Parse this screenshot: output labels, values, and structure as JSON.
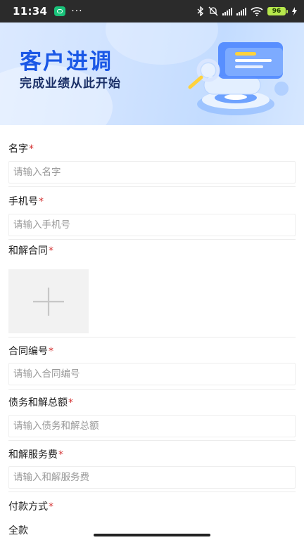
{
  "status_bar": {
    "time": "11:34",
    "more": "···",
    "battery": "96"
  },
  "banner": {
    "title": "客户进调",
    "subtitle": "完成业绩从此开始"
  },
  "form": {
    "name": {
      "label": "名字",
      "required": "*",
      "placeholder": "请输入名字"
    },
    "phone": {
      "label": "手机号",
      "required": "*",
      "placeholder": "请输入手机号"
    },
    "contract": {
      "label": "和解合同",
      "required": "*"
    },
    "contract_no": {
      "label": "合同编号",
      "required": "*",
      "placeholder": "请输入合同编号"
    },
    "debt_total": {
      "label": "债务和解总额",
      "required": "*",
      "placeholder": "请输入债务和解总额"
    },
    "service_fee": {
      "label": "和解服务费",
      "required": "*",
      "placeholder": "请输入和解服务费"
    },
    "payment": {
      "label": "付款方式",
      "required": "*",
      "value": "全款"
    }
  },
  "colors": {
    "accent": "#1b58e6",
    "required": "#d32f2f",
    "placeholder": "#999999"
  }
}
